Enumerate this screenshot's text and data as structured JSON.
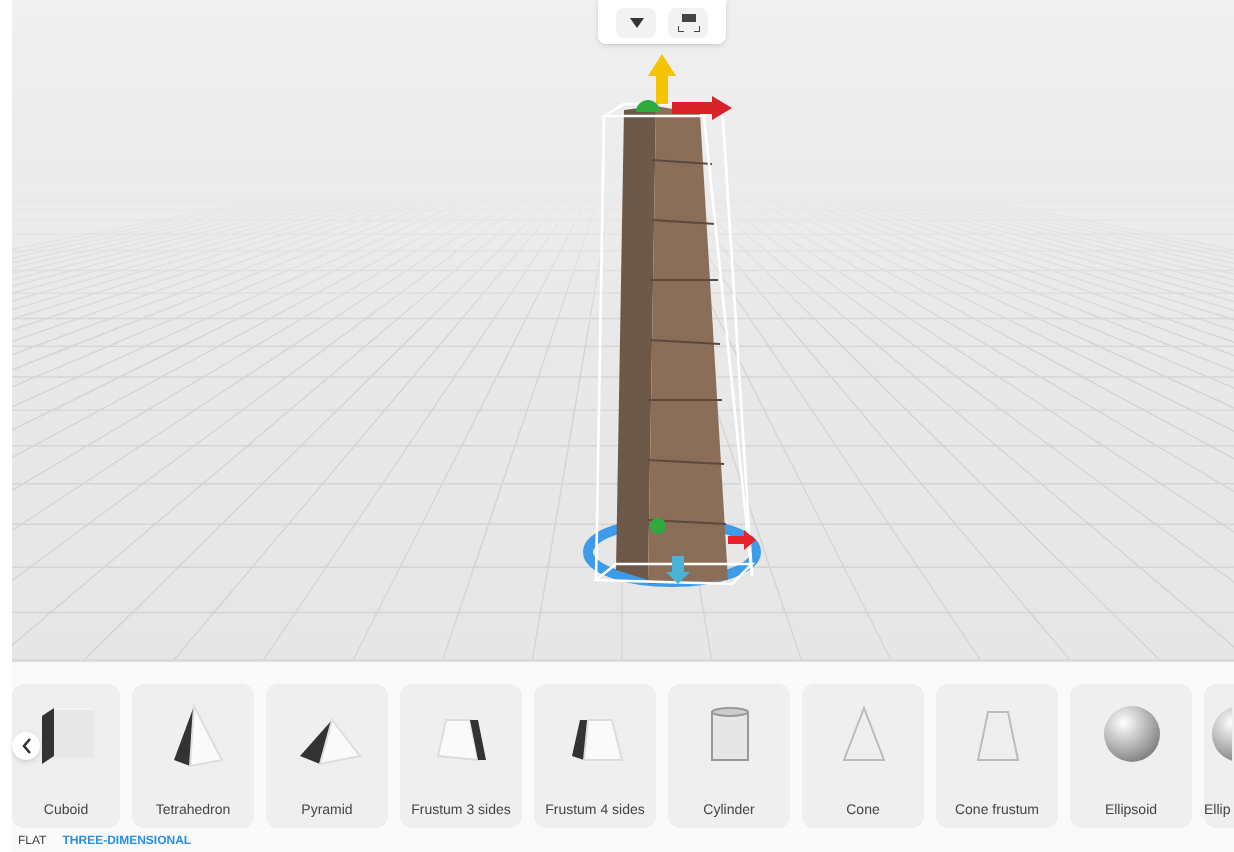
{
  "shapes": [
    {
      "label": "Cuboid",
      "kind": "cuboid"
    },
    {
      "label": "Tetrahedron",
      "kind": "tetrahedron"
    },
    {
      "label": "Pyramid",
      "kind": "pyramid"
    },
    {
      "label": "Frustum 3 sides",
      "kind": "frustum3"
    },
    {
      "label": "Frustum 4 sides",
      "kind": "frustum4"
    },
    {
      "label": "Cylinder",
      "kind": "cylinder"
    },
    {
      "label": "Cone",
      "kind": "cone"
    },
    {
      "label": "Cone frustum",
      "kind": "conefrustum"
    },
    {
      "label": "Ellipsoid",
      "kind": "ellipsoid"
    },
    {
      "label": "Ellip",
      "kind": "ellipsoid"
    }
  ],
  "mode_tabs": [
    {
      "label": "FLAT",
      "selected": false
    },
    {
      "label": "THREE-DIMENSIONAL",
      "selected": true
    }
  ]
}
